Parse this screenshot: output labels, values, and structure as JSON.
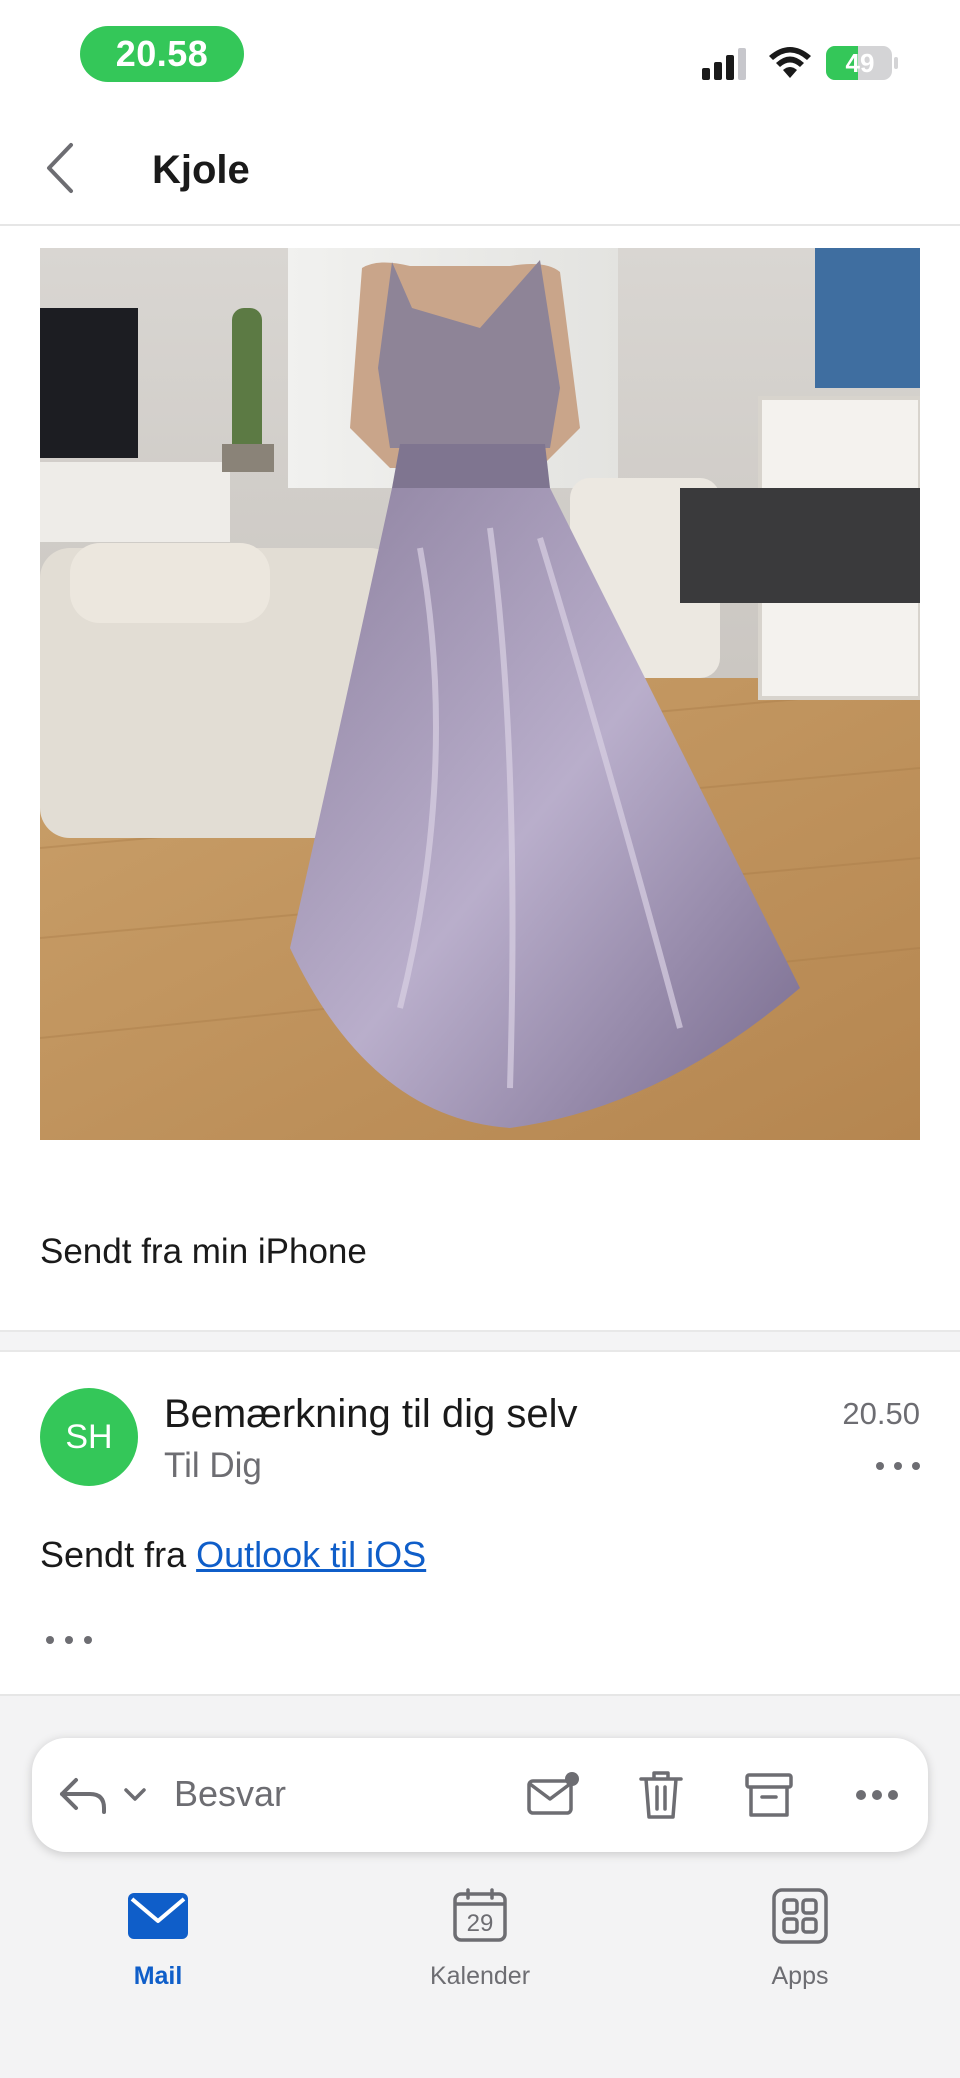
{
  "status_bar": {
    "time": "20.58",
    "battery": "49",
    "battery_level": 0.49
  },
  "header": {
    "title": "Kjole"
  },
  "message1": {
    "photo_description": "Purple tulle evening dress",
    "signature": "Sendt fra min iPhone"
  },
  "message2": {
    "avatar_initials": "SH",
    "subject": "Bemærkning til dig selv",
    "recipient": "Til Dig",
    "time": "20.50",
    "body_prefix": "Sendt fra ",
    "body_link": "Outlook til iOS"
  },
  "reply_bar": {
    "label": "Besvar"
  },
  "tabs": [
    {
      "label": "Mail",
      "icon": "mail-icon",
      "active": true
    },
    {
      "label": "Kalender",
      "icon": "calendar-icon",
      "day": "29",
      "active": false
    },
    {
      "label": "Apps",
      "icon": "apps-icon",
      "active": false
    }
  ],
  "colors": {
    "accent": "#0f5ec9",
    "avatar": "#34c759",
    "status_pill": "#34c759"
  }
}
